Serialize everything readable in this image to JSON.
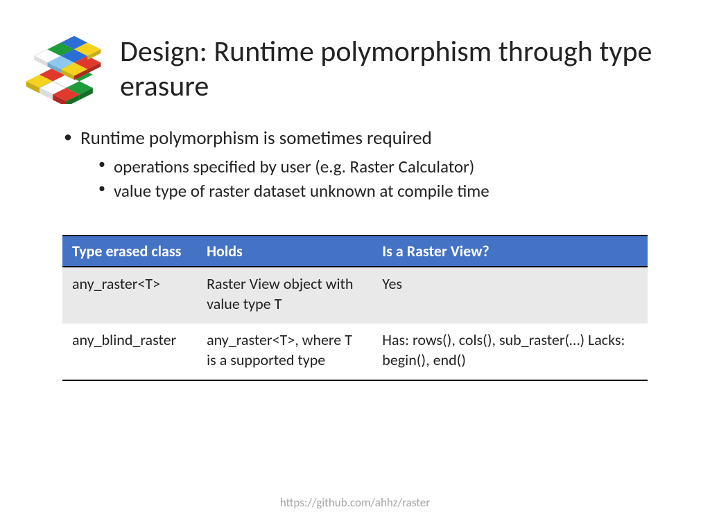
{
  "title": "Design: Runtime polymorphism through type erasure",
  "bullets": {
    "main": "Runtime polymorphism is sometimes required",
    "sub1": "operations specified by user (e.g. Raster Calculator)",
    "sub2": "value type of raster dataset unknown at compile time"
  },
  "table": {
    "headers": [
      "Type erased class",
      "Holds",
      "Is a Raster View?"
    ],
    "rows": [
      {
        "c0": "any_raster<T>",
        "c1": "Raster View object with value type T",
        "c2": "Yes"
      },
      {
        "c0": "any_blind_raster",
        "c1": "any_raster<T>, where T is a supported type",
        "c2": "Has: rows(), cols(), sub_raster(…) Lacks: begin(), end()"
      }
    ]
  },
  "footer": "https://github.com/ahhz/raster"
}
